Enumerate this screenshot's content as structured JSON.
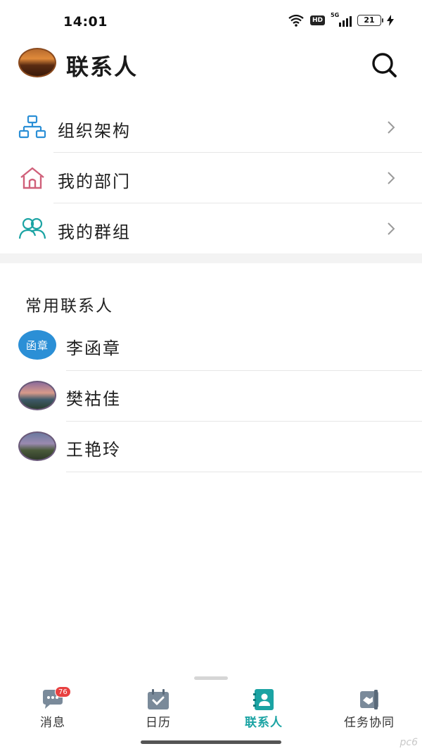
{
  "status_bar": {
    "time": "14:01",
    "network": "5G",
    "hd": "HD",
    "battery": "21"
  },
  "header": {
    "title": "联系人"
  },
  "menu": {
    "items": [
      {
        "label": "组织架构",
        "icon": "org-chart-icon"
      },
      {
        "label": "我的部门",
        "icon": "home-icon"
      },
      {
        "label": "我的群组",
        "icon": "group-icon"
      }
    ]
  },
  "frequent": {
    "title": "常用联系人",
    "contacts": [
      {
        "name": "李函章",
        "avatar_text": "函章"
      },
      {
        "name": "樊祜佳",
        "avatar_text": ""
      },
      {
        "name": "王艳玲",
        "avatar_text": ""
      }
    ]
  },
  "tabbar": {
    "tabs": [
      {
        "label": "消息",
        "icon": "chat-icon",
        "badge": "76"
      },
      {
        "label": "日历",
        "icon": "calendar-icon"
      },
      {
        "label": "联系人",
        "icon": "contacts-book-icon",
        "active": true
      },
      {
        "label": "任务协同",
        "icon": "handshake-icon"
      }
    ]
  },
  "colors": {
    "accent": "#1aa3a3",
    "org_icon": "#2b8fd6",
    "home_icon": "#d0607a",
    "badge": "#e84040"
  },
  "watermark": "pc6"
}
